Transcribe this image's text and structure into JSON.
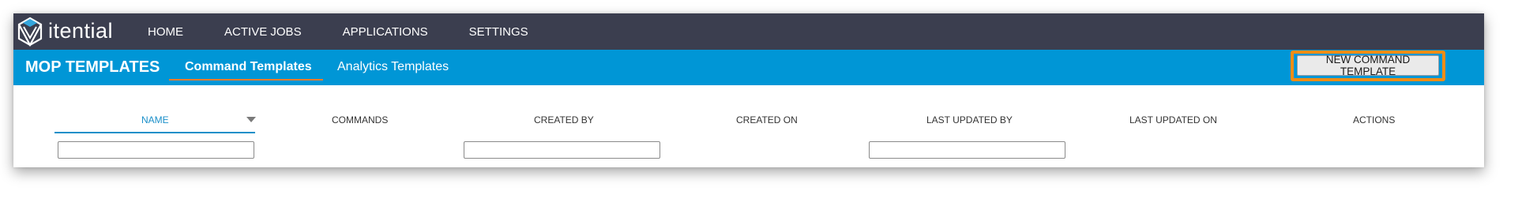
{
  "brand": {
    "logo_text": "itential"
  },
  "topnav": {
    "items": [
      {
        "label": "HOME"
      },
      {
        "label": "ACTIVE JOBS"
      },
      {
        "label": "APPLICATIONS"
      },
      {
        "label": "SETTINGS"
      }
    ]
  },
  "subbar": {
    "title": "MOP TEMPLATES",
    "tabs": [
      {
        "label": "Command Templates",
        "active": true
      },
      {
        "label": "Analytics Templates",
        "active": false
      }
    ],
    "new_button_label": "NEW COMMAND TEMPLATE"
  },
  "table": {
    "columns": [
      {
        "label": "NAME",
        "sorted": true,
        "filter": true
      },
      {
        "label": "COMMANDS",
        "filter": false
      },
      {
        "label": "CREATED BY",
        "filter": true
      },
      {
        "label": "CREATED ON",
        "filter": false
      },
      {
        "label": "LAST UPDATED BY",
        "filter": true
      },
      {
        "label": "LAST UPDATED ON",
        "filter": false
      },
      {
        "label": "ACTIONS",
        "filter": false
      }
    ],
    "filters": {
      "name": {
        "value": "",
        "placeholder": ""
      },
      "created_by": {
        "value": "",
        "placeholder": ""
      },
      "last_updated_by": {
        "value": "",
        "placeholder": ""
      }
    }
  },
  "colors": {
    "topnav_bg": "#3b3e4f",
    "subbar_bg": "#0096d6",
    "tab_underline": "#f47c2b",
    "button_highlight": "#ef8d16",
    "active_column": "#1a8fc9"
  },
  "icons": {
    "logo": "itential-logo-icon",
    "sort": "sort-descending-icon"
  }
}
